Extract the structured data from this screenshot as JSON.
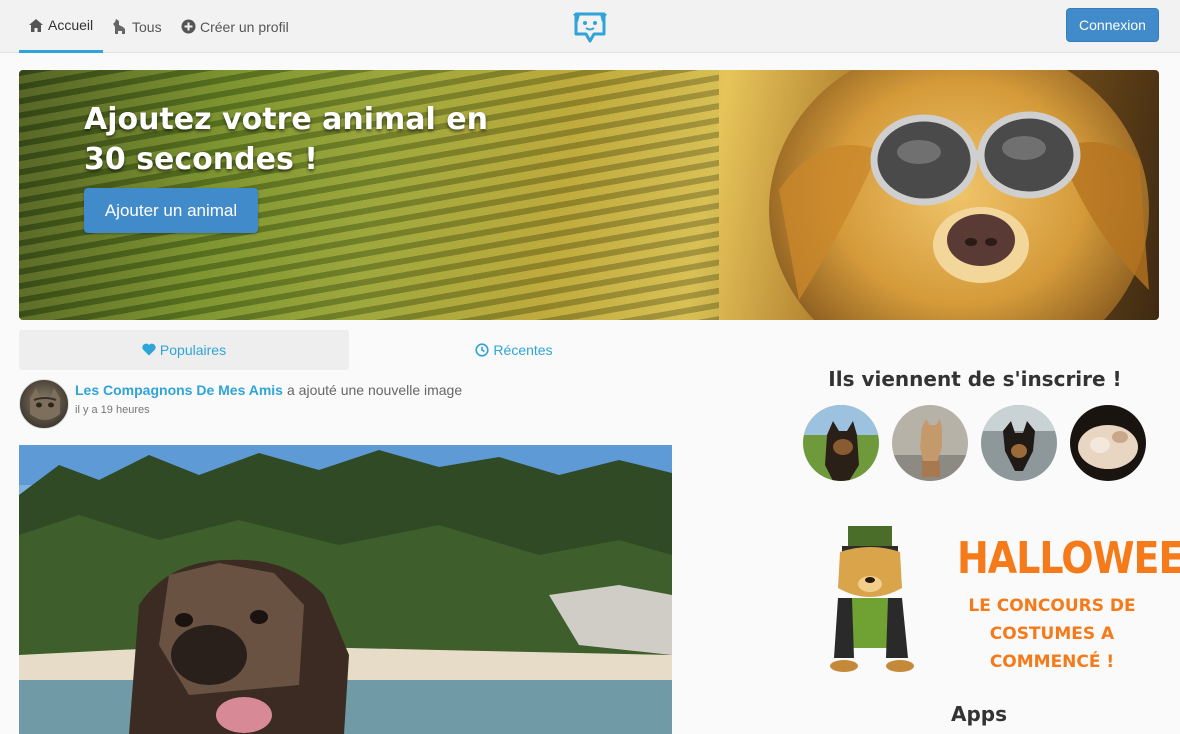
{
  "nav": {
    "home_label": "Accueil",
    "all_label": "Tous",
    "create_label": "Créer un profil",
    "login_label": "Connexion",
    "accent": "#2fa4d8"
  },
  "hero": {
    "title": "Ajoutez votre animal en 30 secondes !",
    "button_label": "Ajouter un animal"
  },
  "tabs": [
    {
      "label": "Populaires",
      "icon": "heart-icon",
      "active": true
    },
    {
      "label": "Récentes",
      "icon": "clock-icon",
      "active": false
    }
  ],
  "post": {
    "author": "Les Compagnons De Mes Amis",
    "action": "a ajouté une nouvelle image",
    "time": "il y a 19 heures"
  },
  "sidebar": {
    "new_members_title": "Ils viennent de s'inscrire !",
    "new_members_count": 4,
    "promo_title": "HALLOWEEN",
    "promo_subtitle": "LE CONCOURS DE COSTUMES A COMMENCÉ !",
    "apps_title": "Apps"
  },
  "colors": {
    "brand_blue": "#428bca",
    "accent_cyan": "#2fa4d8",
    "promo_orange": "#f47a1a"
  }
}
